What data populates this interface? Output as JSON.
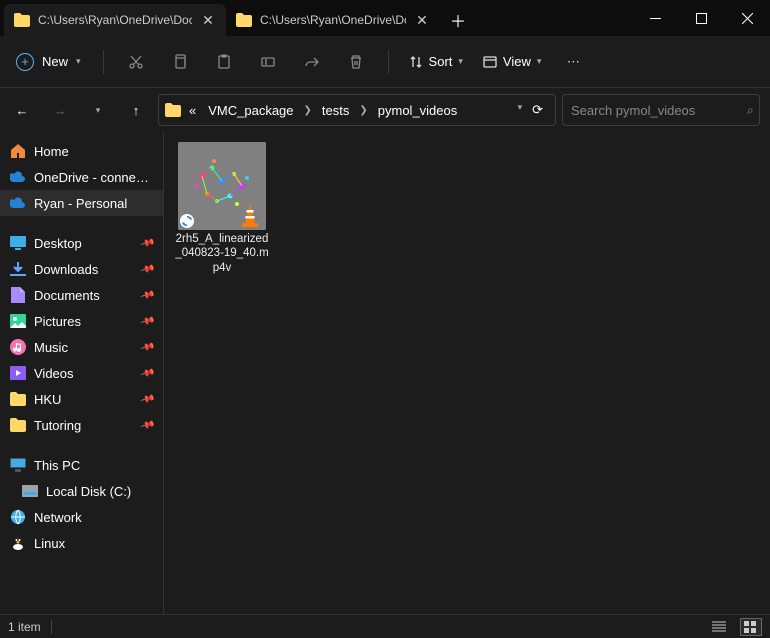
{
  "tabs": [
    {
      "title": "C:\\Users\\Ryan\\OneDrive\\Docu",
      "active": true
    },
    {
      "title": "C:\\Users\\Ryan\\OneDrive\\Docu",
      "active": false
    }
  ],
  "toolbar": {
    "new_label": "New",
    "sort_label": "Sort",
    "view_label": "View"
  },
  "breadcrumb": {
    "overflow": "«",
    "parts": [
      "VMC_package",
      "tests",
      "pymol_videos"
    ]
  },
  "search": {
    "placeholder": "Search pymol_videos"
  },
  "sidebar": {
    "section1": [
      {
        "icon": "home",
        "label": "Home"
      },
      {
        "icon": "onedrive",
        "label": "OneDrive - connect.h"
      },
      {
        "icon": "onedrive",
        "label": "Ryan - Personal",
        "selected": true
      }
    ],
    "quick": [
      {
        "icon": "desktop",
        "label": "Desktop"
      },
      {
        "icon": "downloads",
        "label": "Downloads"
      },
      {
        "icon": "documents",
        "label": "Documents"
      },
      {
        "icon": "pictures",
        "label": "Pictures"
      },
      {
        "icon": "music",
        "label": "Music"
      },
      {
        "icon": "videos",
        "label": "Videos"
      },
      {
        "icon": "folder",
        "label": "HKU"
      },
      {
        "icon": "folder",
        "label": "Tutoring"
      }
    ],
    "section3": [
      {
        "icon": "pc",
        "label": "This PC"
      },
      {
        "icon": "disk",
        "label": "Local Disk (C:)",
        "sub": true
      },
      {
        "icon": "network",
        "label": "Network"
      },
      {
        "icon": "linux",
        "label": "Linux"
      }
    ]
  },
  "files": [
    {
      "name": "2rh5_A_linearized_040823-19_40.mp4v",
      "sync": true,
      "vlc": true
    }
  ],
  "status": {
    "count": "1 item"
  }
}
